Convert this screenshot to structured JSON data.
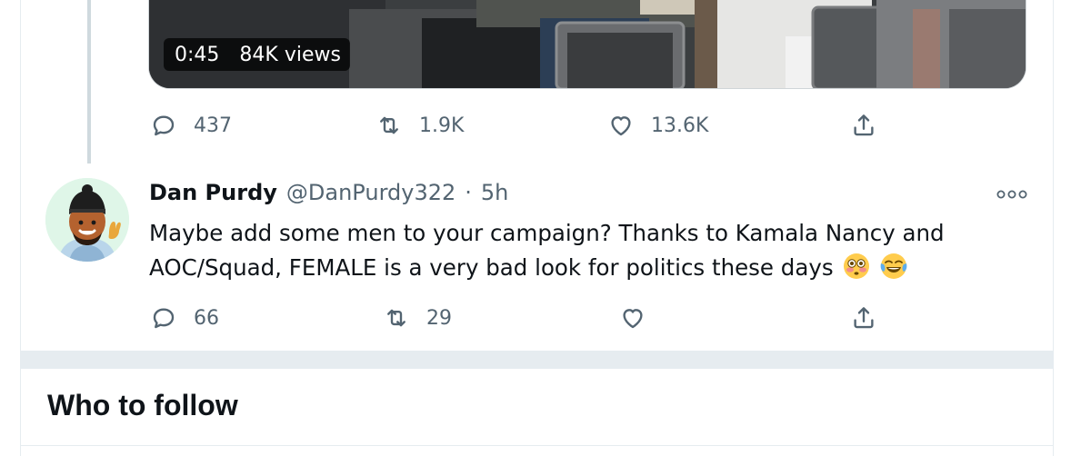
{
  "video": {
    "duration": "0:45",
    "views": "84K views"
  },
  "main_tweet_actions": {
    "replies": "437",
    "retweets": "1.9K",
    "likes": "13.6K"
  },
  "reply_tweet": {
    "name": "Dan Purdy",
    "handle": "@DanPurdy322",
    "separator": "·",
    "time": "5h",
    "text": "Maybe add some men to your campaign? Thanks to Kamala Nancy and AOC/Squad, FEMALE is a very bad look for politics these days",
    "emojis": [
      "flushed-face-emoji",
      "tears-of-joy-emoji"
    ],
    "replies": "66",
    "retweets": "29",
    "likes": ""
  },
  "who_to_follow": {
    "title": "Who to follow"
  },
  "colors": {
    "secondary_text": "#536471",
    "border": "#e6ecf0",
    "thread_line": "#cfd9de"
  }
}
